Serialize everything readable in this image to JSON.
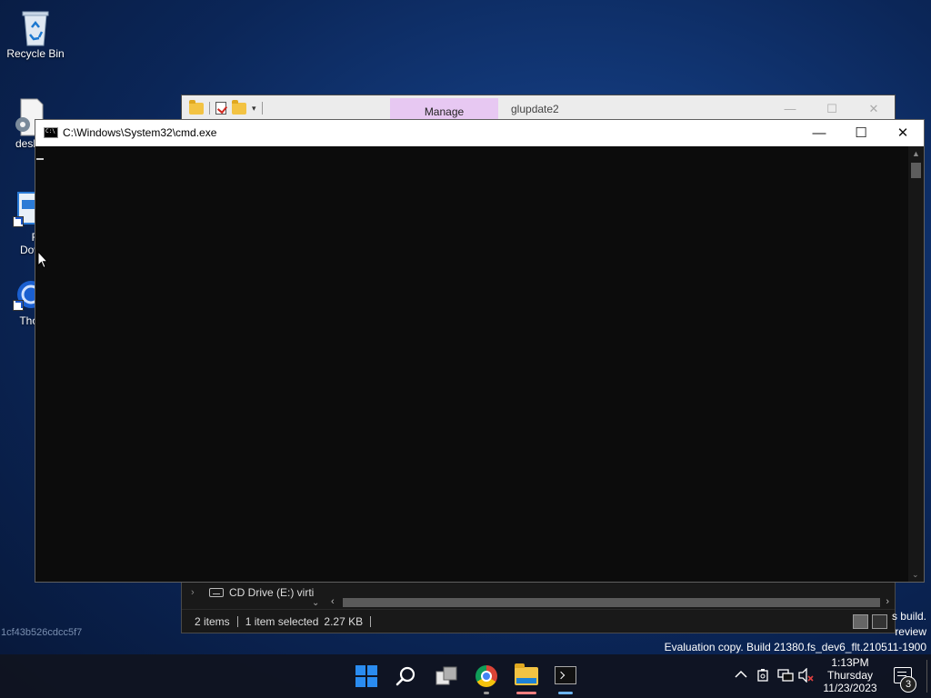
{
  "desktop": {
    "icons": [
      {
        "label": "Recycle Bin"
      },
      {
        "label": "desk"
      },
      {
        "label": "Fr\nDow"
      },
      {
        "label": "Thor"
      }
    ],
    "hash_text": "1cf43b526cdcc5f7",
    "watermark": {
      "line1": "s build.",
      "line2": "review",
      "line3": "Evaluation copy. Build 21380.fs_dev6_flt.210511-1900"
    }
  },
  "explorer": {
    "ribbon_tab": "Manage",
    "title": "glupdate2",
    "controls": {
      "minimize": "—",
      "maximize": "☐",
      "close": "✕"
    },
    "nav_item": "CD Drive (E:) virti",
    "status": {
      "items": "2 items",
      "selected": "1 item selected",
      "size": "2.27 KB"
    }
  },
  "cmd": {
    "title": "C:\\Windows\\System32\\cmd.exe",
    "controls": {
      "minimize": "—",
      "maximize": "☐",
      "close": "✕"
    }
  },
  "taskbar": {
    "clock": {
      "time": "1:13PM",
      "day": "Thursday",
      "date": "11/23/2023"
    },
    "notification_count": "3",
    "icons": [
      "windows-start-icon",
      "search-icon",
      "task-view-icon",
      "chrome-icon",
      "file-explorer-icon",
      "cmd-icon"
    ],
    "tray": [
      "chevron-up-icon",
      "battery-icon",
      "network-icon",
      "volume-muted-icon"
    ]
  },
  "colors": {
    "accent": "#2a8cf0",
    "manage_tab": "#e7c8f2",
    "cmd_bg": "#0c0c0c",
    "explorer_underline": "#f08080",
    "cmd_underline": "#6cb4f0"
  }
}
